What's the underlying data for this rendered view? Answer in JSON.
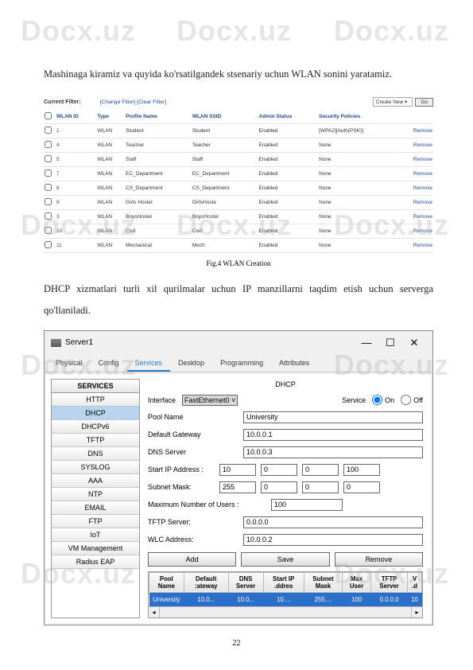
{
  "watermarks": [
    "Docx.uz",
    "Docx.uz",
    "Docx.uz",
    "Docx.uz",
    "Docx.uz",
    "Docx.uz",
    "Docx.uz",
    "Docx.uz",
    "Docx.uz"
  ],
  "paragraph1": "Mashinaga kiramiz va quyida ko'rsatilgandek stsenariy uchun WLAN sonini yaratamiz.",
  "paragraph2": "DHCP xizmatlari turli xil qurilmalar uchun IP manzillarni taqdim etish uchun serverga qo'llaniladi.",
  "wlan": {
    "current_filter_label": "Current Filter:",
    "change_filter": "[Change Filter]",
    "clear_filter": "[Clear Filter]",
    "create_new": "Create New",
    "go": "Go",
    "headers": [
      "",
      "WLAN ID",
      "Type",
      "Profile Name",
      "WLAN SSID",
      "Admin Status",
      "Security Policies",
      ""
    ],
    "rows": [
      {
        "id": "1",
        "type": "WLAN",
        "profile": "Student",
        "ssid": "Student",
        "status": "Enabled",
        "policy": "[WPA2][Auth(PSK)]",
        "remove": "Remove"
      },
      {
        "id": "4",
        "type": "WLAN",
        "profile": "Teacher",
        "ssid": "Teacher",
        "status": "Enabled",
        "policy": "None",
        "remove": "Remove"
      },
      {
        "id": "5",
        "type": "WLAN",
        "profile": "Staff",
        "ssid": "Staff",
        "status": "Enabled",
        "policy": "None",
        "remove": "Remove"
      },
      {
        "id": "7",
        "type": "WLAN",
        "profile": "EC_Department",
        "ssid": "EC_Department",
        "status": "Enabled",
        "policy": "None",
        "remove": "Remove"
      },
      {
        "id": "8",
        "type": "WLAN",
        "profile": "CS_Department",
        "ssid": "CS_Department",
        "status": "Enabled",
        "policy": "None",
        "remove": "Remove"
      },
      {
        "id": "9",
        "type": "WLAN",
        "profile": "Girls Hostel",
        "ssid": "GirlsHoste",
        "status": "Enabled",
        "policy": "None",
        "remove": "Remove"
      },
      {
        "id": "3",
        "type": "WLAN",
        "profile": "BoysHostel",
        "ssid": "BoysHostel",
        "status": "Enabled",
        "policy": "None",
        "remove": "Remove"
      },
      {
        "id": "10",
        "type": "WLAN",
        "profile": "Civil",
        "ssid": "Civil",
        "status": "Enabled",
        "policy": "None",
        "remove": "Remove"
      },
      {
        "id": "11",
        "type": "WLAN",
        "profile": "Mechanical",
        "ssid": "Mech",
        "status": "Enabled",
        "policy": "None",
        "remove": "Remove"
      }
    ]
  },
  "fig_caption": "Fig.4 WLAN Creation",
  "server": {
    "title": "Server1",
    "tabs": [
      "Physical",
      "Config",
      "Services",
      "Desktop",
      "Programming",
      "Attributes"
    ],
    "active_tab": 2,
    "services_header": "SERVICES",
    "services": [
      "HTTP",
      "DHCP",
      "DHCPv6",
      "TFTP",
      "DNS",
      "SYSLOG",
      "AAA",
      "NTP",
      "EMAIL",
      "FTP",
      "IoT",
      "VM Management",
      "Radius EAP"
    ],
    "active_service": 1,
    "dhcp": {
      "title": "DHCP",
      "interface_label": "Interface",
      "interface_value": "FastEthernet0",
      "service_label": "Service",
      "on_label": "On",
      "off_label": "Off",
      "pool_name_label": "Pool Name",
      "pool_name_value": "University",
      "gateway_label": "Default Gateway",
      "gateway_value": "10.0.0.1",
      "dns_label": "DNS Server",
      "dns_value": "10.0.0.3",
      "start_ip_label": "Start IP Address :",
      "start_ip": [
        "10",
        "0",
        "0",
        "100"
      ],
      "subnet_label": "Subnet Mask:",
      "subnet": [
        "255",
        "0",
        "0",
        "0"
      ],
      "max_users_label": "Maximum Number of Users :",
      "max_users_value": "100",
      "tftp_label": "TFTP Server:",
      "tftp_value": "0.0.0.0",
      "wlc_label": "WLC Address:",
      "wlc_value": "10.0.0.2",
      "add_btn": "Add",
      "save_btn": "Save",
      "remove_btn": "Remove",
      "table_headers": [
        "Pool Name",
        "Default :ateway",
        "DNS Server",
        "Start IP .ddres",
        "Subnet Mask",
        "Max User",
        "TFTP Server",
        "V .d"
      ],
      "table_row": [
        "University",
        "10.0...",
        "10.0...",
        "10....",
        "255....",
        "100",
        "0.0.0.0",
        "10"
      ]
    }
  },
  "page_number": "22"
}
